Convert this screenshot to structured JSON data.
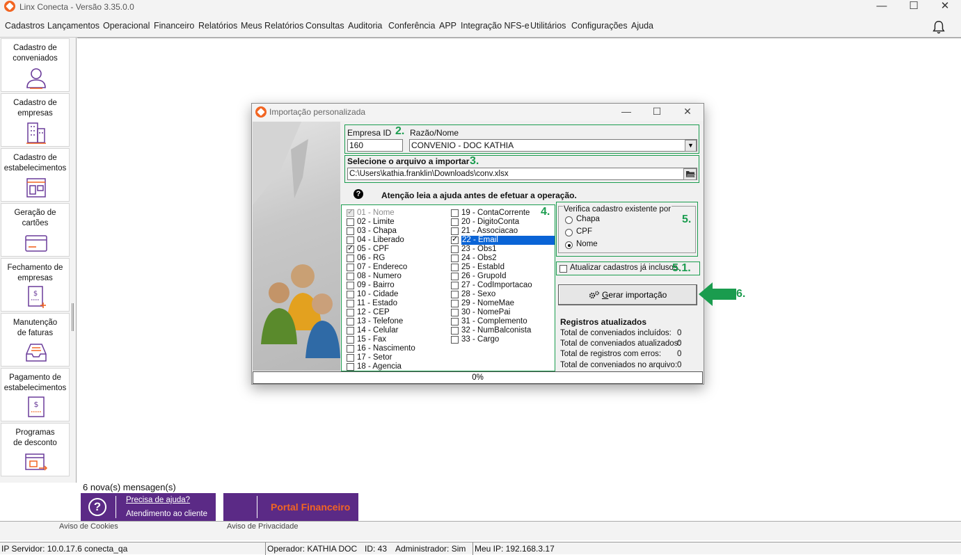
{
  "window": {
    "title": "Linx Conecta - Versão 3.35.0.0",
    "controls": [
      "—",
      "☐",
      "✕"
    ]
  },
  "menu": [
    "Cadastros",
    "Lançamentos",
    "Operacional",
    "Financeiro",
    "Relatórios",
    "Meus Relatórios",
    "Consultas",
    "Auditoria",
    "Conferência",
    "APP",
    "Integração NFS-e",
    "Utilitários",
    "Configurações",
    "Ajuda"
  ],
  "sidebar": [
    {
      "label1": "Cadastro de",
      "label2": "conveniados",
      "icon": "user-icon"
    },
    {
      "label1": "Cadastro de",
      "label2": "empresas",
      "icon": "building-icon"
    },
    {
      "label1": "Cadastro de",
      "label2": "estabelecimentos",
      "icon": "store-icon"
    },
    {
      "label1": "Geração de",
      "label2": "cartões",
      "icon": "card-icon"
    },
    {
      "label1": "Fechamento de",
      "label2": "empresas",
      "icon": "invoice-icon"
    },
    {
      "label1": "Manutenção",
      "label2": "de faturas",
      "icon": "inbox-icon"
    },
    {
      "label1": "Pagamento de",
      "label2": "estabelecimentos",
      "icon": "payment-icon"
    },
    {
      "label1": "Programas",
      "label2": "de desconto",
      "icon": "discount-icon"
    }
  ],
  "messages": "6 nova(s) mensagen(s)",
  "help_banner": {
    "line1": "Precisa de ajuda?",
    "line2": "Atendimento ao cliente",
    "icon": "?"
  },
  "portal_banner": {
    "label": "Portal Financeiro"
  },
  "bottom_strip": {
    "left": "Aviso de Cookies",
    "right": "Aviso de Privacidade"
  },
  "status": {
    "server": "IP Servidor: 10.0.17.6 conecta_qa",
    "operator": "Operador: KATHIA DOC",
    "id": "ID: 43",
    "admin": "Administrador: Sim",
    "ip": "Meu IP: 192.168.3.17"
  },
  "dialog": {
    "title": "Importação personalizada",
    "controls": [
      "—",
      "☐",
      "✕"
    ],
    "empresa_id_label": "Empresa ID",
    "empresa_id_value": "160",
    "razao_label": "Razão/Nome",
    "razao_value": "CONVENIO -  DOC KATHIA",
    "arquivo_label": "Selecione o arquivo a importar",
    "arquivo_value": "C:\\Users\\kathia.franklin\\Downloads\\conv.xlsx",
    "help_icon": "?",
    "aviso": "Atenção leia a ajuda antes de efetuar a operação.",
    "annotations": {
      "a2": "2.",
      "a3": "3.",
      "a4": "4.",
      "a5": "5.",
      "a51": "5.1.",
      "a6": "6."
    },
    "fields_col1": [
      {
        "label": "01 - Nome",
        "checked": true,
        "disabled": true
      },
      {
        "label": "02 - Limite",
        "checked": false
      },
      {
        "label": "03 - Chapa",
        "checked": false
      },
      {
        "label": "04 - Liberado",
        "checked": false
      },
      {
        "label": "05 - CPF",
        "checked": true
      },
      {
        "label": "06 - RG",
        "checked": false
      },
      {
        "label": "07 - Endereco",
        "checked": false
      },
      {
        "label": "08 - Numero",
        "checked": false
      },
      {
        "label": "09 - Bairro",
        "checked": false
      },
      {
        "label": "10 - Cidade",
        "checked": false
      },
      {
        "label": "11 - Estado",
        "checked": false
      },
      {
        "label": "12 - CEP",
        "checked": false
      },
      {
        "label": "13 - Telefone",
        "checked": false
      },
      {
        "label": "14 - Celular",
        "checked": false
      },
      {
        "label": "15 - Fax",
        "checked": false
      },
      {
        "label": "16 - Nascimento",
        "checked": false
      },
      {
        "label": "17 - Setor",
        "checked": false
      },
      {
        "label": "18 - Agencia",
        "checked": false
      }
    ],
    "fields_col2": [
      {
        "label": "19 - ContaCorrente",
        "checked": false
      },
      {
        "label": "20 - DigitoConta",
        "checked": false
      },
      {
        "label": "21 - Associacao",
        "checked": false
      },
      {
        "label": "22 - Email",
        "checked": true,
        "selected": true
      },
      {
        "label": "23 - Obs1",
        "checked": false
      },
      {
        "label": "24 - Obs2",
        "checked": false
      },
      {
        "label": "25 - EstabId",
        "checked": false
      },
      {
        "label": "26 - GrupoId",
        "checked": false
      },
      {
        "label": "27 - CodImportacao",
        "checked": false
      },
      {
        "label": "28 - Sexo",
        "checked": false
      },
      {
        "label": "29 - NomeMae",
        "checked": false
      },
      {
        "label": "30 - NomePai",
        "checked": false
      },
      {
        "label": "31 - Complemento",
        "checked": false
      },
      {
        "label": "32 - NumBalconista",
        "checked": false
      },
      {
        "label": "33 - Cargo",
        "checked": false
      }
    ],
    "verifica_label": "Verifica cadastro existente por",
    "verifica_options": [
      {
        "label": "Chapa",
        "selected": false
      },
      {
        "label": "CPF",
        "selected": false
      },
      {
        "label": "Nome",
        "selected": true
      }
    ],
    "atualizar_label": "Atualizar cadastros já inclusos.",
    "gerar_button": "Gerar importação",
    "registros_title": "Registros atualizados",
    "registros": [
      {
        "label": "Total de conveniados incluídos:",
        "value": "0"
      },
      {
        "label": "Total de conveniados atualizados:",
        "value": "0"
      },
      {
        "label": "Total de registros com erros:",
        "value": "0"
      },
      {
        "label": "Total de conveniados no arquivo:",
        "value": "0"
      }
    ],
    "progress": "0%"
  },
  "colors": {
    "brand_purple": "#5b2a86",
    "brand_orange": "#f26522",
    "annotation_green": "#1a9c4e",
    "selection_blue": "#0a64d6"
  }
}
